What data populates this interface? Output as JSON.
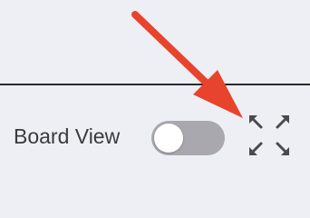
{
  "toolbar": {
    "board_view_label": "Board View",
    "board_view_toggle": {
      "on": false
    },
    "expand_icon": "expand-icon"
  },
  "annotation": {
    "arrow_icon": "callout-arrow-icon",
    "arrow_color": "#e8432c"
  },
  "colors": {
    "background": "#eeeff5",
    "toggle_track_off": "#a8a8ae",
    "icon": "#4a4a4d"
  }
}
